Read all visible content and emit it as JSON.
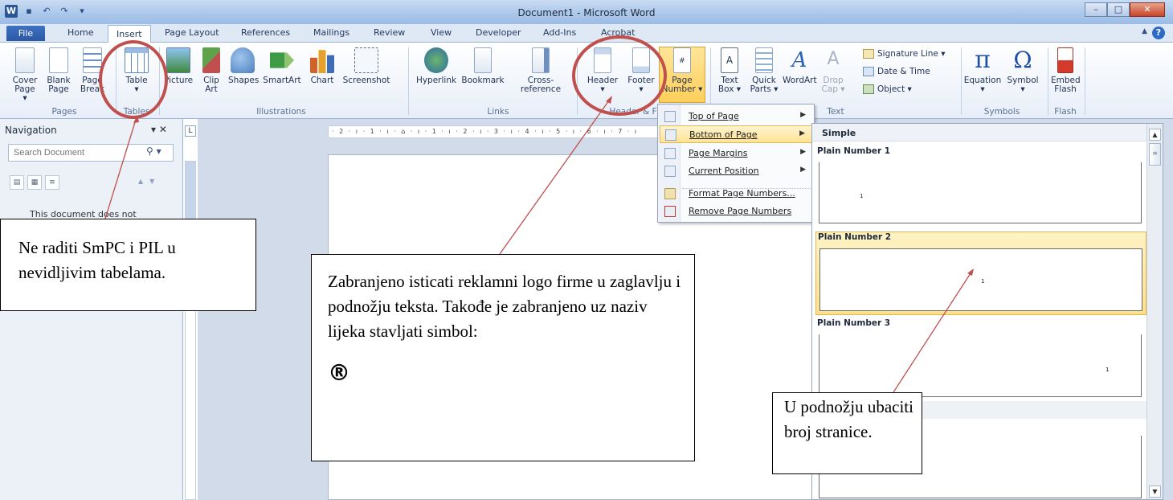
{
  "window": {
    "title": "Document1 - Microsoft Word"
  },
  "tabs": [
    "File",
    "Home",
    "Insert",
    "Page Layout",
    "References",
    "Mailings",
    "Review",
    "View",
    "Developer",
    "Add-Ins",
    "Acrobat"
  ],
  "ribbon": {
    "pages": {
      "cover_l1": "Cover",
      "cover_l2": "Page ▾",
      "blank_l1": "Blank",
      "blank_l2": "Page",
      "break_l1": "Page",
      "break_l2": "Break",
      "label": "Pages"
    },
    "tables": {
      "table_l1": "Table",
      "table_l2": "▾",
      "label": "Tables"
    },
    "illustrations": {
      "picture": "Picture",
      "clip_l1": "Clip",
      "clip_l2": "Art",
      "shapes": "Shapes",
      "smartart": "SmartArt",
      "chart": "Chart",
      "screenshot": "Screenshot",
      "label": "Illustrations"
    },
    "links": {
      "hyperlink": "Hyperlink",
      "bookmark": "Bookmark",
      "crossref": "Cross-reference",
      "label": "Links"
    },
    "header_footer": {
      "header": "Header",
      "footer": "Footer",
      "page_l1": "Page",
      "page_l2": "Number ▾",
      "label": "Header & F"
    },
    "text": {
      "textbox_l1": "Text",
      "textbox_l2": "Box ▾",
      "quick_l1": "Quick",
      "quick_l2": "Parts ▾",
      "wordart": "WordArt",
      "drop_l1": "Drop",
      "drop_l2": "Cap ▾",
      "signature": "Signature Line ▾",
      "datetime": "Date & Time",
      "object": "Object ▾",
      "label": "Text"
    },
    "symbols": {
      "equation": "Equation",
      "symbol": "Symbol",
      "label": "Symbols"
    },
    "flash": {
      "embed_l1": "Embed",
      "embed_l2": "Flash",
      "label": "Flash"
    }
  },
  "navigation": {
    "title": "Navigation",
    "search_placeholder": "Search Document",
    "message": "This document does not"
  },
  "page_number_menu": {
    "items": [
      {
        "label": "Top of Page",
        "submenu": true
      },
      {
        "label": "Bottom of Page",
        "submenu": true,
        "highlighted": true
      },
      {
        "label": "Page Margins",
        "submenu": true
      },
      {
        "label": "Current Position",
        "submenu": true
      },
      {
        "label": "Format Page Numbers...",
        "submenu": false
      },
      {
        "label": "Remove Page Numbers",
        "submenu": false
      }
    ]
  },
  "gallery": {
    "section": "Simple",
    "items": [
      {
        "title": "Plain Number 1",
        "number": "1"
      },
      {
        "title": "Plain Number 2",
        "number": "1",
        "selected": true
      },
      {
        "title": "Plain Number 3",
        "number": "1"
      }
    ]
  },
  "annotations": {
    "tables_note": "Ne raditi SmPC i PIL u nevidljivim tabelama.",
    "header_note": "Zabranjeno isticati reklamni logo firme u zaglavlju i podnožju teksta. Takođe je zabranjeno uz naziv lijeka stavljati simbol:",
    "header_symbol": "®",
    "footer_note": "U podnožju ubaciti broj stranice.",
    "accent_color": "#c0504d"
  },
  "ruler_text": "· 2 · ı · 1 · ı · ⌂ · ı · 1 · ı · 2 · ı · 3 · ı · 4 · ı · 5 · ı · 6 · ı · 7 · ı"
}
